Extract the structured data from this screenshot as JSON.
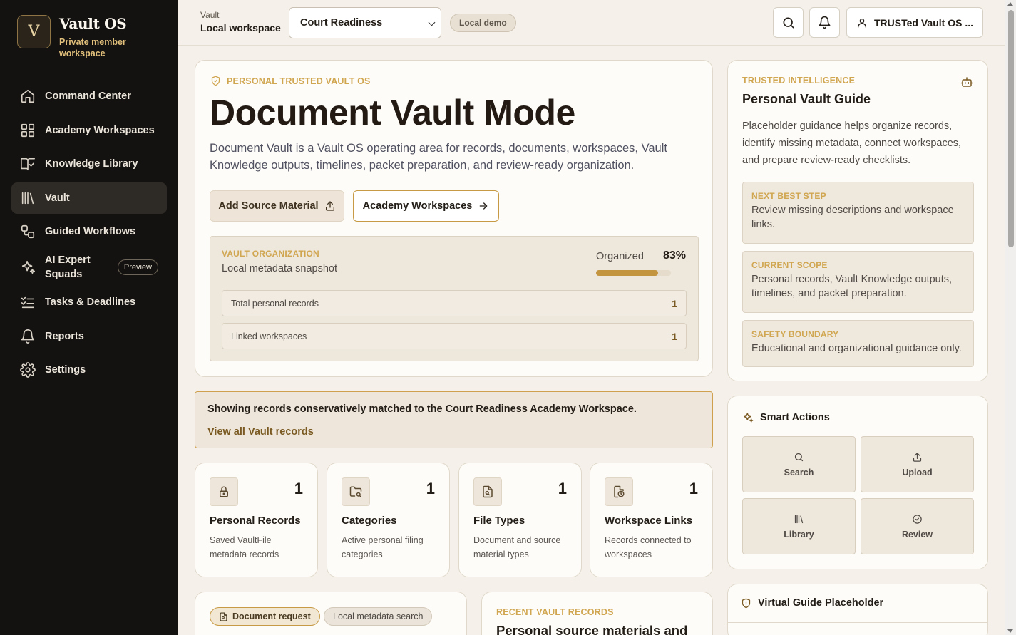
{
  "brand": {
    "mark": "V",
    "title": "Vault OS",
    "subtitle": "Private member workspace"
  },
  "sidebar": {
    "items": [
      {
        "label": "Command Center",
        "icon": "home-icon"
      },
      {
        "label": "Academy Workspaces",
        "icon": "grid-icon"
      },
      {
        "label": "Knowledge Library",
        "icon": "book-check-icon"
      },
      {
        "label": "Vault",
        "icon": "library-icon",
        "active": true
      },
      {
        "label": "Guided Workflows",
        "icon": "workflow-icon"
      },
      {
        "label": "AI Expert Squads",
        "icon": "sparkles-icon",
        "badge": "Preview"
      },
      {
        "label": "Tasks & Deadlines",
        "icon": "list-checks-icon"
      },
      {
        "label": "Reports",
        "icon": "bell-icon"
      },
      {
        "label": "Settings",
        "icon": "gear-icon"
      }
    ]
  },
  "topbar": {
    "workspace_label": "Vault",
    "workspace_name": "Local workspace",
    "selected_workspace": "Court Readiness",
    "demo_badge": "Local demo",
    "user_label": "TRUSTed Vault OS ..."
  },
  "hero": {
    "eyebrow": "PERSONAL TRUSTED VAULT OS",
    "title": "Document Vault Mode",
    "description": "Document Vault is a Vault OS operating area for records, documents, workspaces, Vault Knowledge outputs, timelines, packet preparation, and review-ready organization.",
    "primary_button": "Add Source Material",
    "secondary_button": "Academy Workspaces",
    "organization": {
      "eyebrow": "VAULT ORGANIZATION",
      "subtitle": "Local metadata snapshot",
      "progress_label": "Organized",
      "progress_value": "83%",
      "progress_fraction": 0.83,
      "rows": [
        {
          "label": "Total personal records",
          "value": "1"
        },
        {
          "label": "Linked workspaces",
          "value": "1"
        }
      ]
    }
  },
  "notice": {
    "text": "Showing records conservatively matched to the Court Readiness Academy Workspace.",
    "link": "View all Vault records"
  },
  "stats": [
    {
      "title": "Personal Records",
      "value": "1",
      "description": "Saved VaultFile metadata records",
      "icon": "lock-icon"
    },
    {
      "title": "Categories",
      "value": "1",
      "description": "Active personal filing categories",
      "icon": "folder-search-icon"
    },
    {
      "title": "File Types",
      "value": "1",
      "description": "Document and source material types",
      "icon": "file-search-icon"
    },
    {
      "title": "Workspace Links",
      "value": "1",
      "description": "Records connected to workspaces",
      "icon": "file-clock-icon"
    }
  ],
  "bottom_left": {
    "chip_active": "Document request",
    "chip_inactive": "Local metadata search"
  },
  "bottom_mid": {
    "eyebrow": "RECENT VAULT RECORDS",
    "title": "Personal source materials and"
  },
  "guide": {
    "eyebrow": "TRUSTED INTELLIGENCE",
    "title": "Personal Vault Guide",
    "description": "Placeholder guidance helps organize records, identify missing metadata, connect workspaces, and prepare review-ready checklists.",
    "boxes": [
      {
        "title": "NEXT BEST STEP",
        "text": "Review missing descriptions and workspace links."
      },
      {
        "title": "CURRENT SCOPE",
        "text": "Personal records, Vault Knowledge outputs, timelines, and packet preparation."
      },
      {
        "title": "SAFETY BOUNDARY",
        "text": "Educational and organizational guidance only."
      }
    ]
  },
  "smart_actions": {
    "title": "Smart Actions",
    "buttons": [
      {
        "label": "Search",
        "icon": "search-icon"
      },
      {
        "label": "Upload",
        "icon": "upload-icon"
      },
      {
        "label": "Library",
        "icon": "library-icon"
      },
      {
        "label": "Review",
        "icon": "check-circle-icon"
      }
    ]
  },
  "virtual_guide": {
    "title": "Virtual Guide Placeholder"
  },
  "colors": {
    "sidebar_bg": "#141210",
    "accent_gold": "#d0a650",
    "page_bg": "#f5f1ea",
    "card_bg": "#fefcf8"
  }
}
